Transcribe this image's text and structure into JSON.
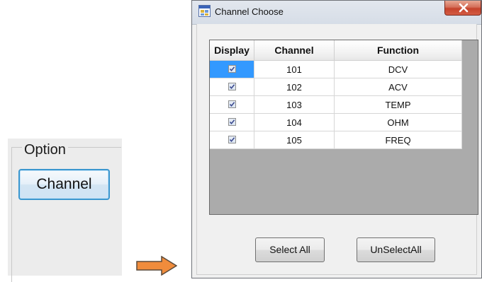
{
  "option_group": {
    "legend": "Option",
    "channel_button_label": "Channel"
  },
  "dialog": {
    "title": "Channel Choose",
    "close_symbol": "x",
    "grid": {
      "columns": [
        "Display",
        "Channel",
        "Function"
      ],
      "rows": [
        {
          "display": true,
          "channel": "101",
          "function": "DCV",
          "selected": true
        },
        {
          "display": true,
          "channel": "102",
          "function": "ACV"
        },
        {
          "display": true,
          "channel": "103",
          "function": "TEMP"
        },
        {
          "display": true,
          "channel": "104",
          "function": "OHM"
        },
        {
          "display": true,
          "channel": "105",
          "function": "FREQ"
        }
      ]
    },
    "buttons": {
      "select_all": "Select All",
      "unselect_all": "UnSelectAll"
    }
  },
  "colors": {
    "arrow_fill": "#f08c3c",
    "arrow_stroke": "#5a4a3a",
    "selection": "#3399ff",
    "channel_button_border": "#3c97cf"
  }
}
